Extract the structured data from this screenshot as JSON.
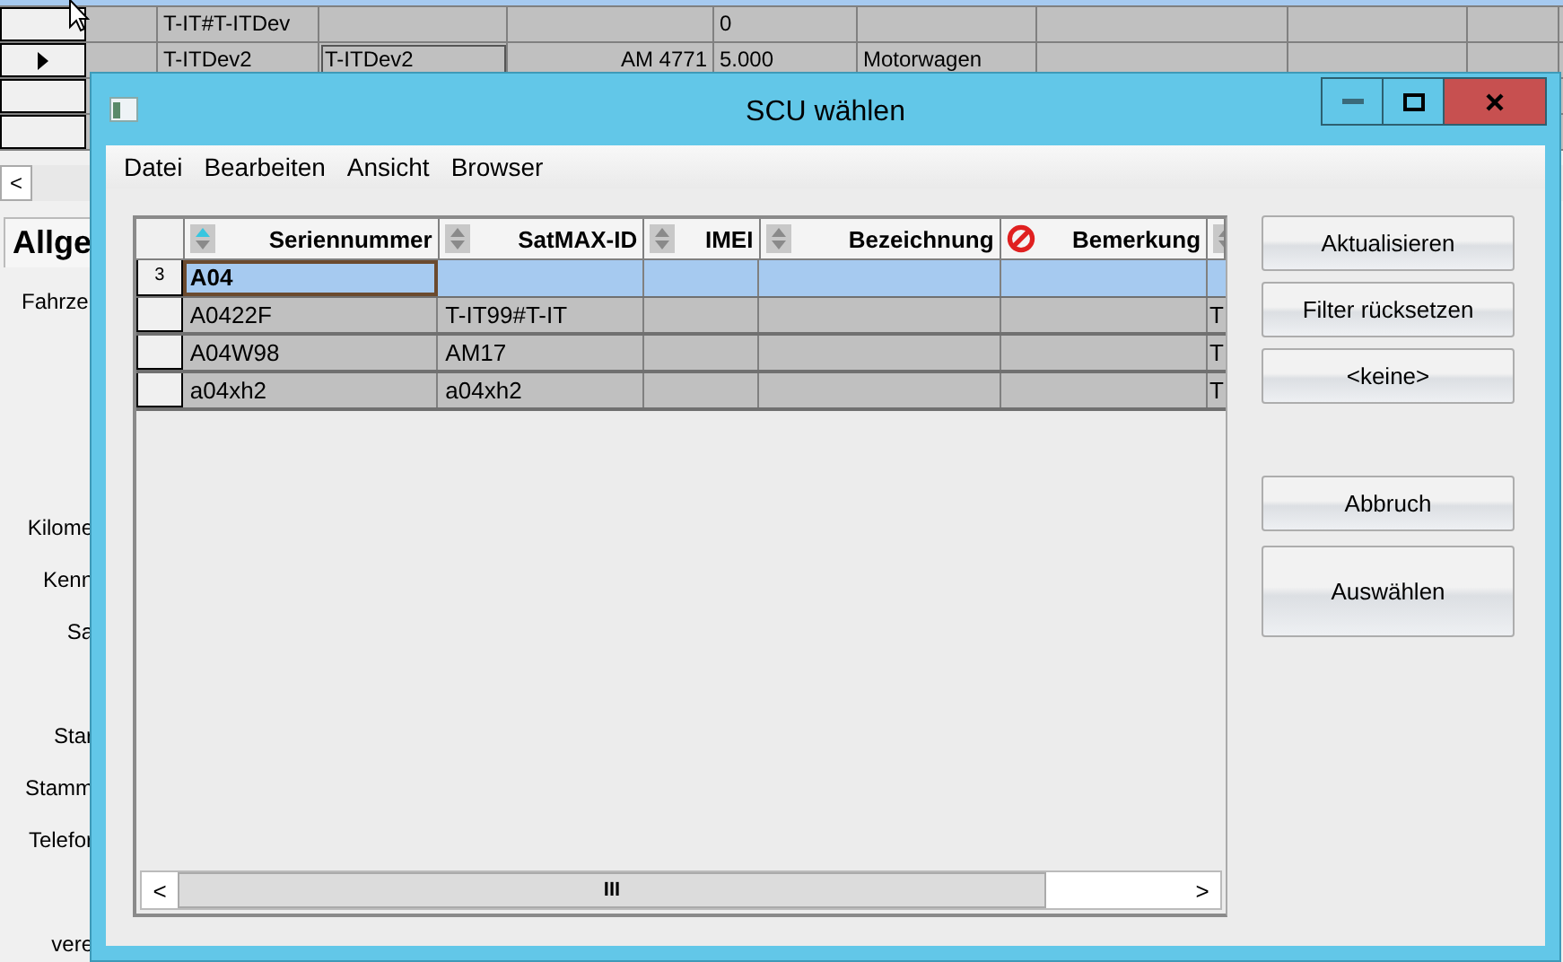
{
  "background_window": {
    "grid": {
      "rows": [
        {
          "current": false,
          "cells": [
            "",
            "T-IT#T-ITDev",
            "",
            "",
            "0",
            "",
            "",
            "",
            ""
          ]
        },
        {
          "current": true,
          "cells": [
            "",
            "T-ITDev2",
            "T-ITDev2",
            "AM 4771",
            "5.000",
            "Motorwagen",
            "",
            "",
            ""
          ]
        },
        {
          "current": false
        },
        {
          "current": false
        }
      ]
    },
    "scroll_left": "<",
    "tab": "Allge",
    "group": "Fahrze",
    "labels": [
      "Kilome",
      "Kenn",
      "Sa",
      "Star",
      "Stamm",
      "Telefor",
      "vere"
    ]
  },
  "dialog": {
    "title": "SCU wählen",
    "window_buttons": [
      {
        "kind": "minimize"
      },
      {
        "kind": "maximize"
      },
      {
        "kind": "close"
      }
    ],
    "menu": [
      "Datei",
      "Bearbeiten",
      "Ansicht",
      "Browser"
    ],
    "table": {
      "columns": [
        {
          "label": "Seriennummer",
          "kind": "sorted"
        },
        {
          "label": "SatMAX-ID",
          "kind": "sortable"
        },
        {
          "label": "IMEI",
          "kind": "sortable"
        },
        {
          "label": "Bezeichnung",
          "kind": "sortable"
        },
        {
          "label": "Bemerkung",
          "kind": "blocked"
        },
        {
          "kind": "sortable"
        }
      ],
      "rows": [
        {
          "header": "3",
          "selected": true,
          "cells": [
            "A04",
            "",
            "",
            "",
            "",
            ""
          ]
        },
        {
          "header": "",
          "selected": false,
          "cells": [
            "A0422F",
            "T-IT99#T-IT",
            "",
            "",
            "",
            "T"
          ]
        },
        {
          "header": "",
          "selected": false,
          "cells": [
            "A04W98",
            "AM17",
            "",
            "",
            "",
            "T"
          ]
        },
        {
          "header": "",
          "selected": false,
          "cells": [
            "a04xh2",
            "a04xh2",
            "",
            "",
            "",
            "T"
          ]
        }
      ],
      "scroll_left": "<",
      "scroll_right": ">",
      "scroll_thumb": "III"
    },
    "buttons": [
      {
        "label": "Aktualisieren",
        "kind": "normal"
      },
      {
        "label": "Filter rücksetzen",
        "kind": "normal"
      },
      {
        "label": "<keine>",
        "kind": "normal"
      },
      {
        "label": "Abbruch",
        "kind": "spaced"
      },
      {
        "label": "Auswählen",
        "kind": "tall"
      }
    ]
  }
}
